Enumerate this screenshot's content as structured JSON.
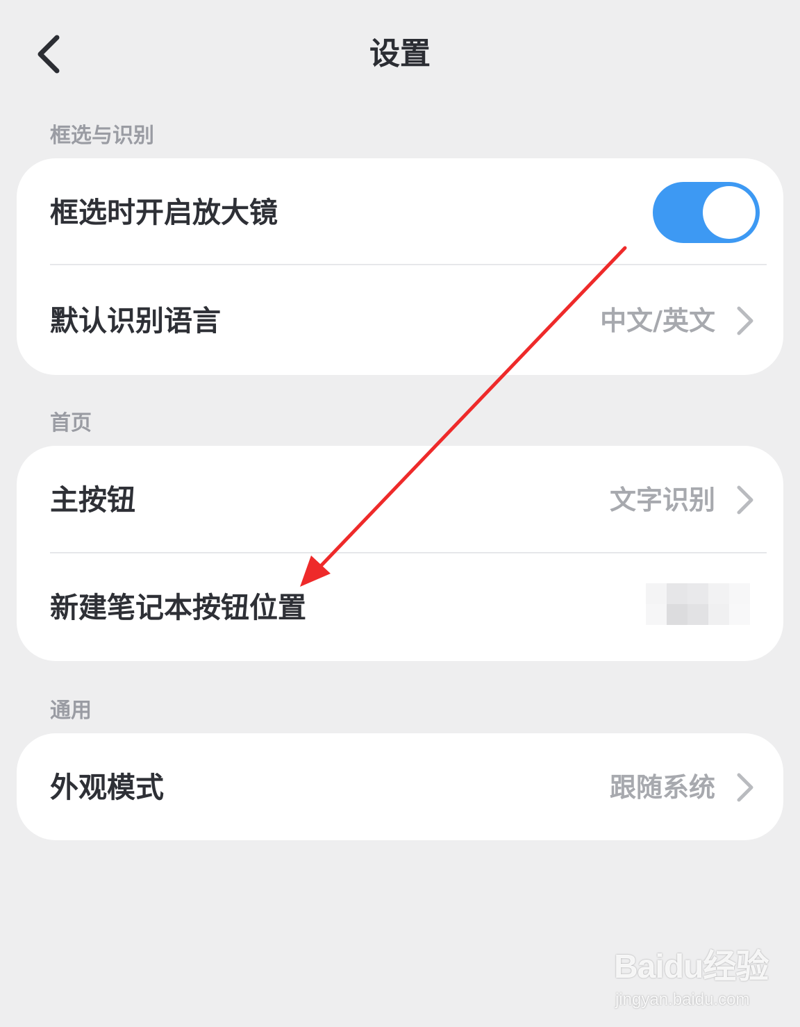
{
  "header": {
    "title": "设置",
    "back_icon": "chevron-left-icon"
  },
  "sections": [
    {
      "label": "框选与识别",
      "rows": [
        {
          "label": "框选时开启放大镜",
          "control": "toggle",
          "toggle_on": true
        },
        {
          "label": "默认识别语言",
          "value": "中文/英文",
          "control": "chevron"
        }
      ]
    },
    {
      "label": "首页",
      "rows": [
        {
          "label": "主按钮",
          "value": "文字识别",
          "control": "chevron"
        },
        {
          "label": "新建笔记本按钮位置",
          "value": "",
          "control": "obscured"
        }
      ]
    },
    {
      "label": "通用",
      "rows": [
        {
          "label": "外观模式",
          "value": "跟随系统",
          "control": "chevron"
        }
      ]
    }
  ],
  "annotation": {
    "type": "red-arrow",
    "color": "#ee2a2a"
  },
  "watermark": {
    "brand": "Baidu经验",
    "url": "jingyan.baidu.com"
  },
  "colors": {
    "background": "#eeeeef",
    "card": "#ffffff",
    "toggle_on": "#3d99f3",
    "primary_text": "#2e3036",
    "secondary_text": "#a7a9ae",
    "section_label": "#9a9ca3"
  }
}
